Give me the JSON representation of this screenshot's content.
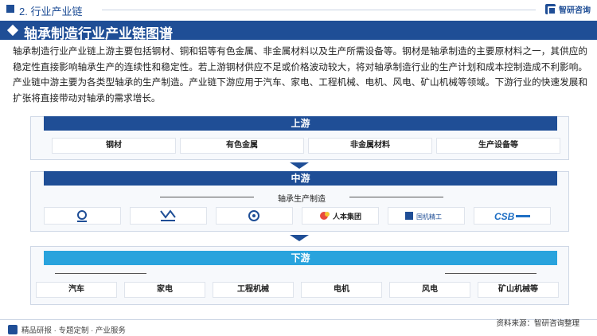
{
  "header": {
    "section": "2. 行业产业链",
    "brand": "智研咨询"
  },
  "title": "轴承制造行业产业链图谱",
  "description": "轴承制造行业产业链上游主要包括钢材、铜和铝等有色金属、非金属材料以及生产所需设备等。钢材是轴承制造的主要原材料之一，其供应的稳定性直接影响轴承生产的连续性和稳定性。若上游钢材供应不足或价格波动较大，将对轴承制造行业的生产计划和成本控制造成不利影响。产业链中游主要为各类型轴承的生产制造。产业链下游应用于汽车、家电、工程机械、电机、风电、矿山机械等领域。下游行业的快速发展和扩张将直接带动对轴承的需求增长。",
  "upstream": {
    "title": "上游",
    "items": [
      "钢材",
      "有色金属",
      "非金属材料",
      "生产设备等"
    ]
  },
  "midstream": {
    "title": "中游",
    "subtitle": "轴承生产制造",
    "logos": [
      {
        "icon": "company-logo-1",
        "text": ""
      },
      {
        "icon": "company-logo-2",
        "text": ""
      },
      {
        "icon": "company-logo-3",
        "text": ""
      },
      {
        "icon": "company-logo-4",
        "text": "人本集团"
      },
      {
        "icon": "company-logo-5",
        "text": "国机精工"
      },
      {
        "icon": "company-logo-6",
        "text": "CSB"
      }
    ]
  },
  "downstream": {
    "title": "下游",
    "items": [
      "汽车",
      "家电",
      "工程机械",
      "电机",
      "风电",
      "矿山机械等"
    ]
  },
  "footer": {
    "tagline": "精品研报 · 专题定制 · 产业服务",
    "source": "资料来源：智研咨询整理"
  },
  "colors": {
    "primary": "#1f4e96",
    "accent": "#29a3dd"
  }
}
